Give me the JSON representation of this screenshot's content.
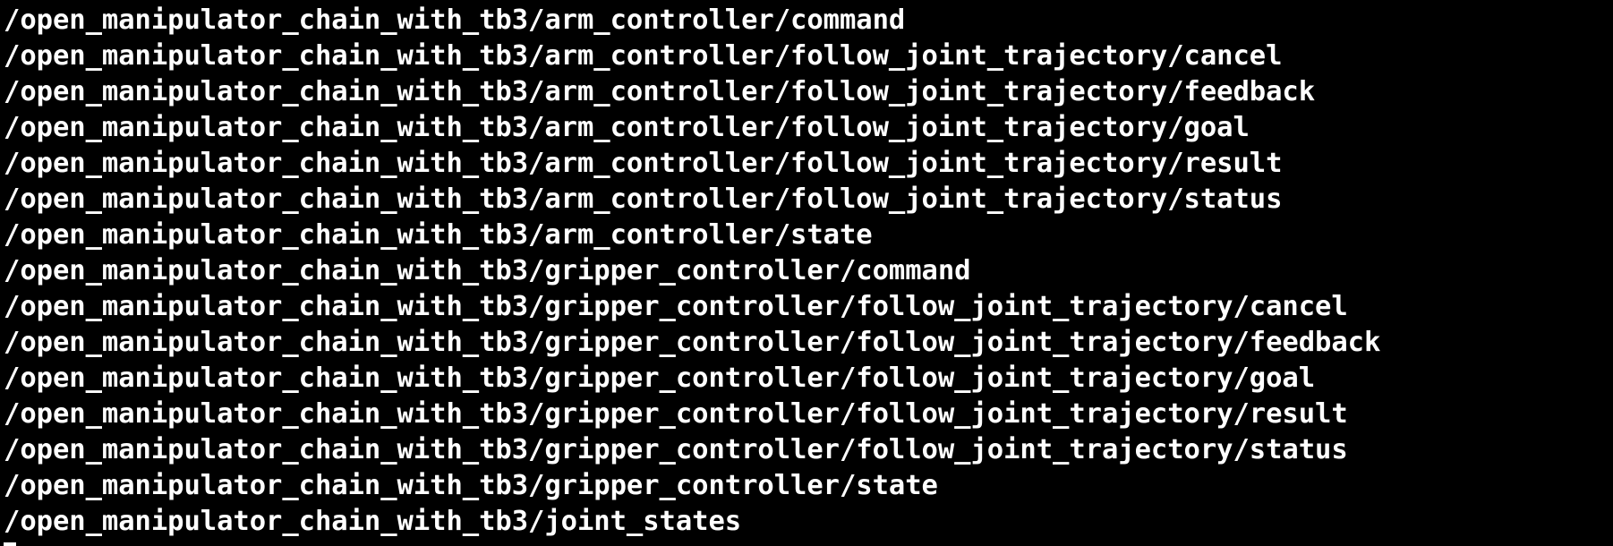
{
  "terminal": {
    "lines": [
      "/open_manipulator_chain_with_tb3/arm_controller/command",
      "/open_manipulator_chain_with_tb3/arm_controller/follow_joint_trajectory/cancel",
      "/open_manipulator_chain_with_tb3/arm_controller/follow_joint_trajectory/feedback",
      "/open_manipulator_chain_with_tb3/arm_controller/follow_joint_trajectory/goal",
      "/open_manipulator_chain_with_tb3/arm_controller/follow_joint_trajectory/result",
      "/open_manipulator_chain_with_tb3/arm_controller/follow_joint_trajectory/status",
      "/open_manipulator_chain_with_tb3/arm_controller/state",
      "/open_manipulator_chain_with_tb3/gripper_controller/command",
      "/open_manipulator_chain_with_tb3/gripper_controller/follow_joint_trajectory/cancel",
      "/open_manipulator_chain_with_tb3/gripper_controller/follow_joint_trajectory/feedback",
      "/open_manipulator_chain_with_tb3/gripper_controller/follow_joint_trajectory/goal",
      "/open_manipulator_chain_with_tb3/gripper_controller/follow_joint_trajectory/result",
      "/open_manipulator_chain_with_tb3/gripper_controller/follow_joint_trajectory/status",
      "/open_manipulator_chain_with_tb3/gripper_controller/state",
      "/open_manipulator_chain_with_tb3/joint_states"
    ],
    "colors": {
      "background": "#000000",
      "foreground": "#ffffff"
    }
  }
}
